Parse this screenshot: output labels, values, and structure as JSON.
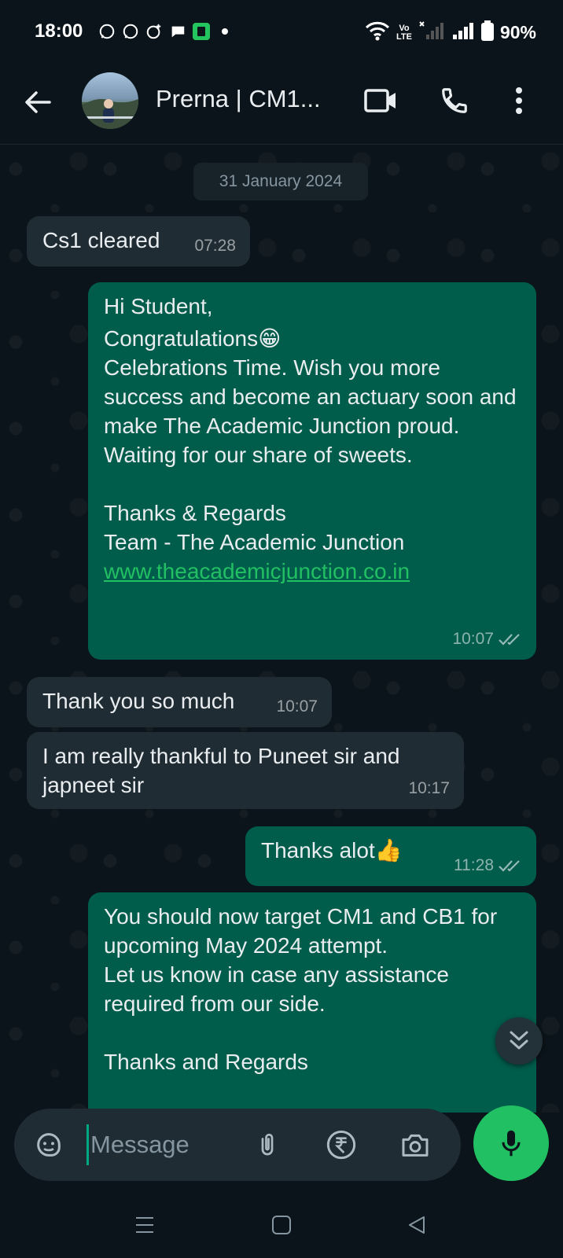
{
  "status_bar": {
    "time": "18:00",
    "volte_top": "Vo",
    "volte_bottom": "LTE",
    "battery": "90%"
  },
  "header": {
    "contact_name": "Prerna | CM1...",
    "icons": [
      "back-arrow-icon",
      "video-call-icon",
      "phone-icon",
      "more-vert-icon"
    ]
  },
  "chat": {
    "date": "31 January 2024",
    "messages": [
      {
        "type": "incoming",
        "text": "Cs1 cleared",
        "time": "07:28"
      },
      {
        "type": "outgoing",
        "line1": "Hi Student,",
        "line2": "Congratulations😁",
        "line3": "Celebrations Time. Wish you more success and become an actuary soon and make The Academic Junction proud.\nWaiting for our share of sweets.",
        "line4": "Thanks & Regards\nTeam - The Academic Junction",
        "link": "www.theacademicjunction.co.in",
        "time": "10:07"
      },
      {
        "type": "incoming",
        "text": "Thank you so much",
        "time": "10:07"
      },
      {
        "type": "incoming",
        "text": "I am really thankful to Puneet sir and japneet sir",
        "time": "10:17"
      },
      {
        "type": "outgoing",
        "text": "Thanks alot👍",
        "time": "11:28"
      },
      {
        "type": "outgoing",
        "text": "You should now target CM1 and CB1 for upcoming May 2024 attempt.\nLet us know in case any assistance required from our side.",
        "text2": "Thanks and Regards"
      }
    ]
  },
  "composer": {
    "placeholder": "Message",
    "icons": [
      "sticker-icon",
      "attach-icon",
      "rupee-payment-icon",
      "camera-icon",
      "mic-icon"
    ]
  },
  "colors": {
    "background": "#0b141a",
    "incoming_bubble": "#202c33",
    "outgoing_bubble": "#005c4b",
    "accent_green": "#21c063"
  }
}
